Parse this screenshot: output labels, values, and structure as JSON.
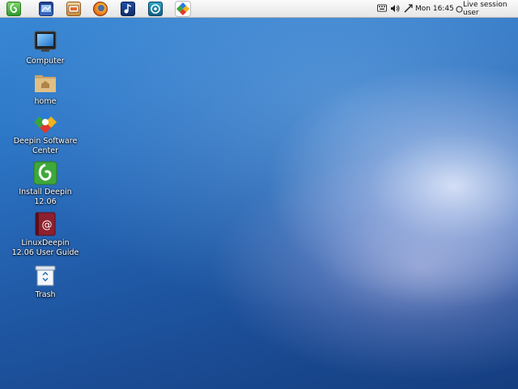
{
  "panel": {
    "launchers": [
      {
        "icon": "deepin-logo-icon"
      },
      {
        "icon": "screenshot-icon"
      },
      {
        "icon": "image-viewer-icon"
      },
      {
        "icon": "firefox-icon"
      },
      {
        "icon": "music-player-icon"
      },
      {
        "icon": "chat-icon"
      },
      {
        "icon": "software-center-icon"
      }
    ],
    "tray": {
      "clock": "Mon 16:45",
      "session": "Live session user"
    }
  },
  "desktop": {
    "icons": [
      {
        "label": "Computer",
        "icon": "computer-icon"
      },
      {
        "label": "home",
        "icon": "home-folder-icon"
      },
      {
        "label": "Deepin Software\nCenter",
        "icon": "software-center-icon"
      },
      {
        "label": "Install Deepin\n12.06",
        "icon": "install-icon"
      },
      {
        "label": "LinuxDeepin\n12.06 User Guide",
        "icon": "user-guide-icon"
      },
      {
        "label": "Trash",
        "icon": "trash-icon"
      }
    ]
  },
  "colors": {
    "accent": "#2565b4",
    "panel": "#f0f0f0"
  }
}
